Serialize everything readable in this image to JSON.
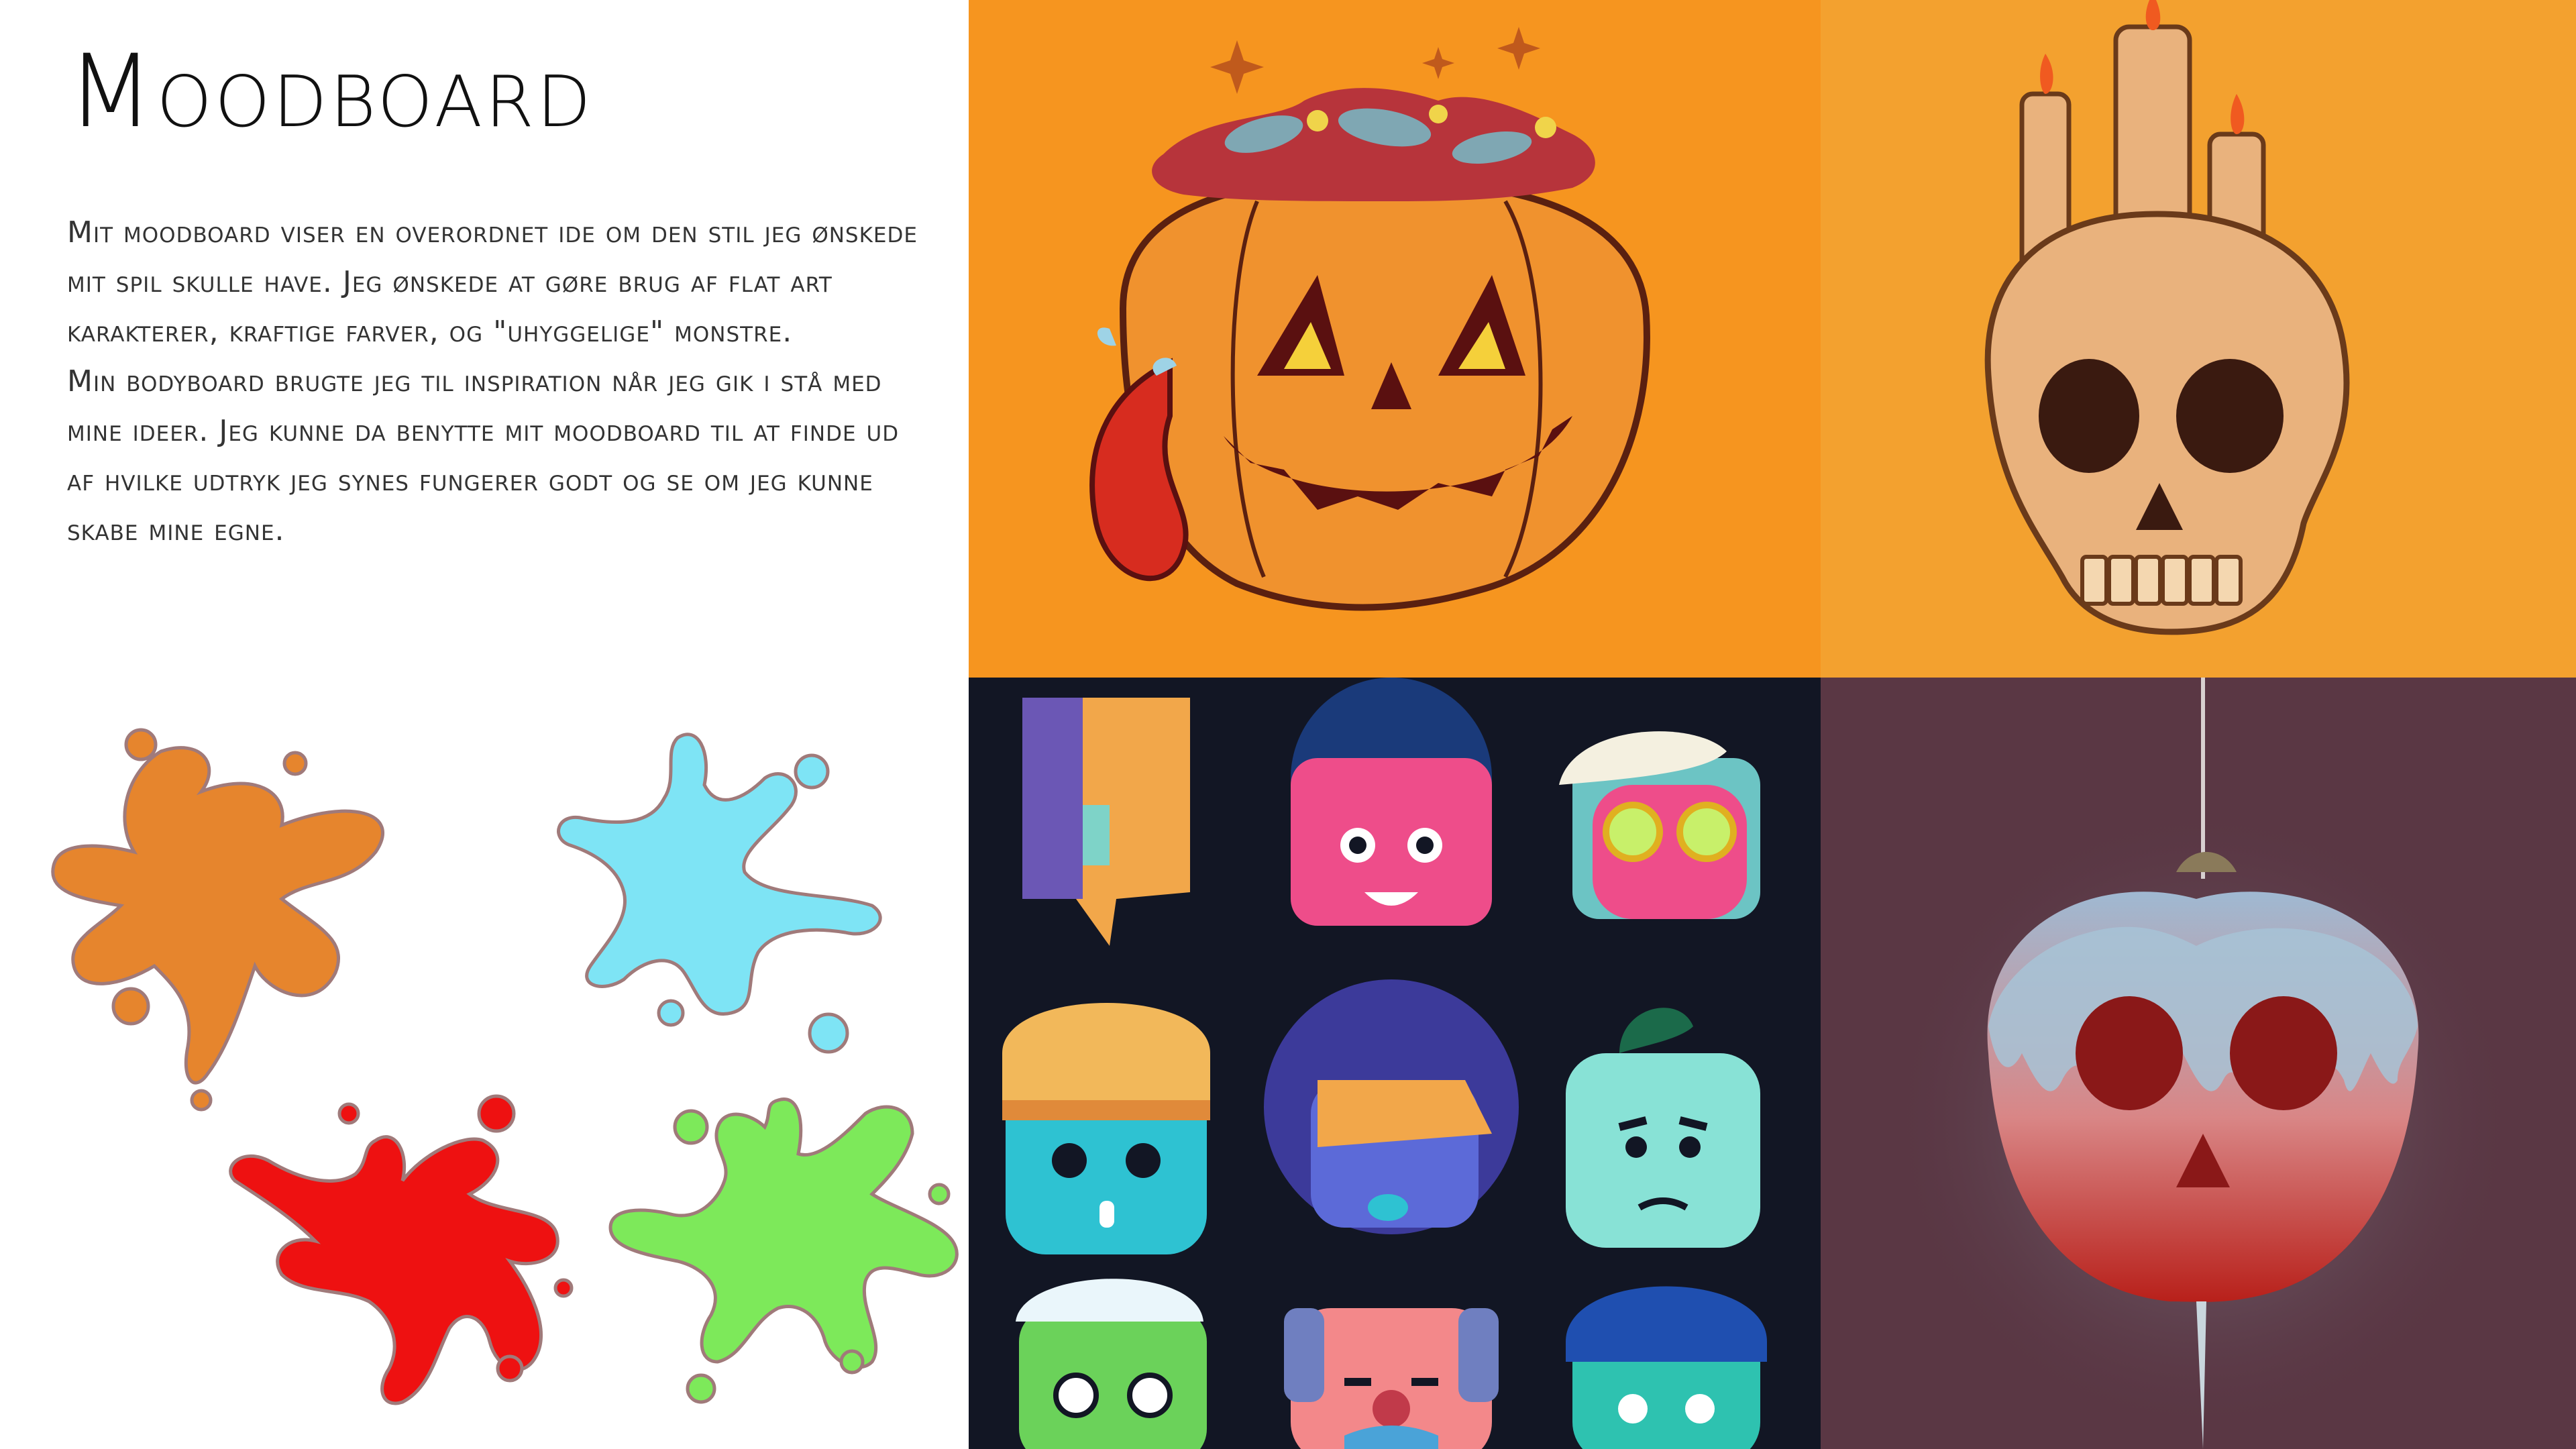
{
  "slide": {
    "title": "Moodboard",
    "paragraphs": [
      "Mit moodboard viser en overordnet ide om den stil jeg ønskede mit spil skulle have. Jeg ønskede at gøre brug af flat art karakterer, kraftige farver, og \"uhyggelige\" monstre.",
      "Min bodyboard brugte jeg til inspiration når jeg gik i stå med mine ideer. Jeg kunne da benytte mit moodboard til at finde ud af hvilke udtryk jeg synes fungerer godt og se om jeg kunne skabe mine egne."
    ]
  },
  "colors": {
    "splatter_orange": "#e6852d",
    "splatter_cyan": "#7ee4f5",
    "splatter_red": "#ee1111",
    "splatter_green": "#7de95a",
    "panel_pumpkin_bg": "#f6951f",
    "panel_skull_bg": "#f3a12f",
    "panel_faces_bg": "#121624",
    "panel_apple_bg": "#5a3744"
  },
  "images": {
    "pumpkin": "jack-o-lantern-illustration",
    "skull": "skull-with-candles-illustration",
    "faces": "flat-character-faces-grid",
    "apple": "poisoned-apple-skull-illustration"
  }
}
